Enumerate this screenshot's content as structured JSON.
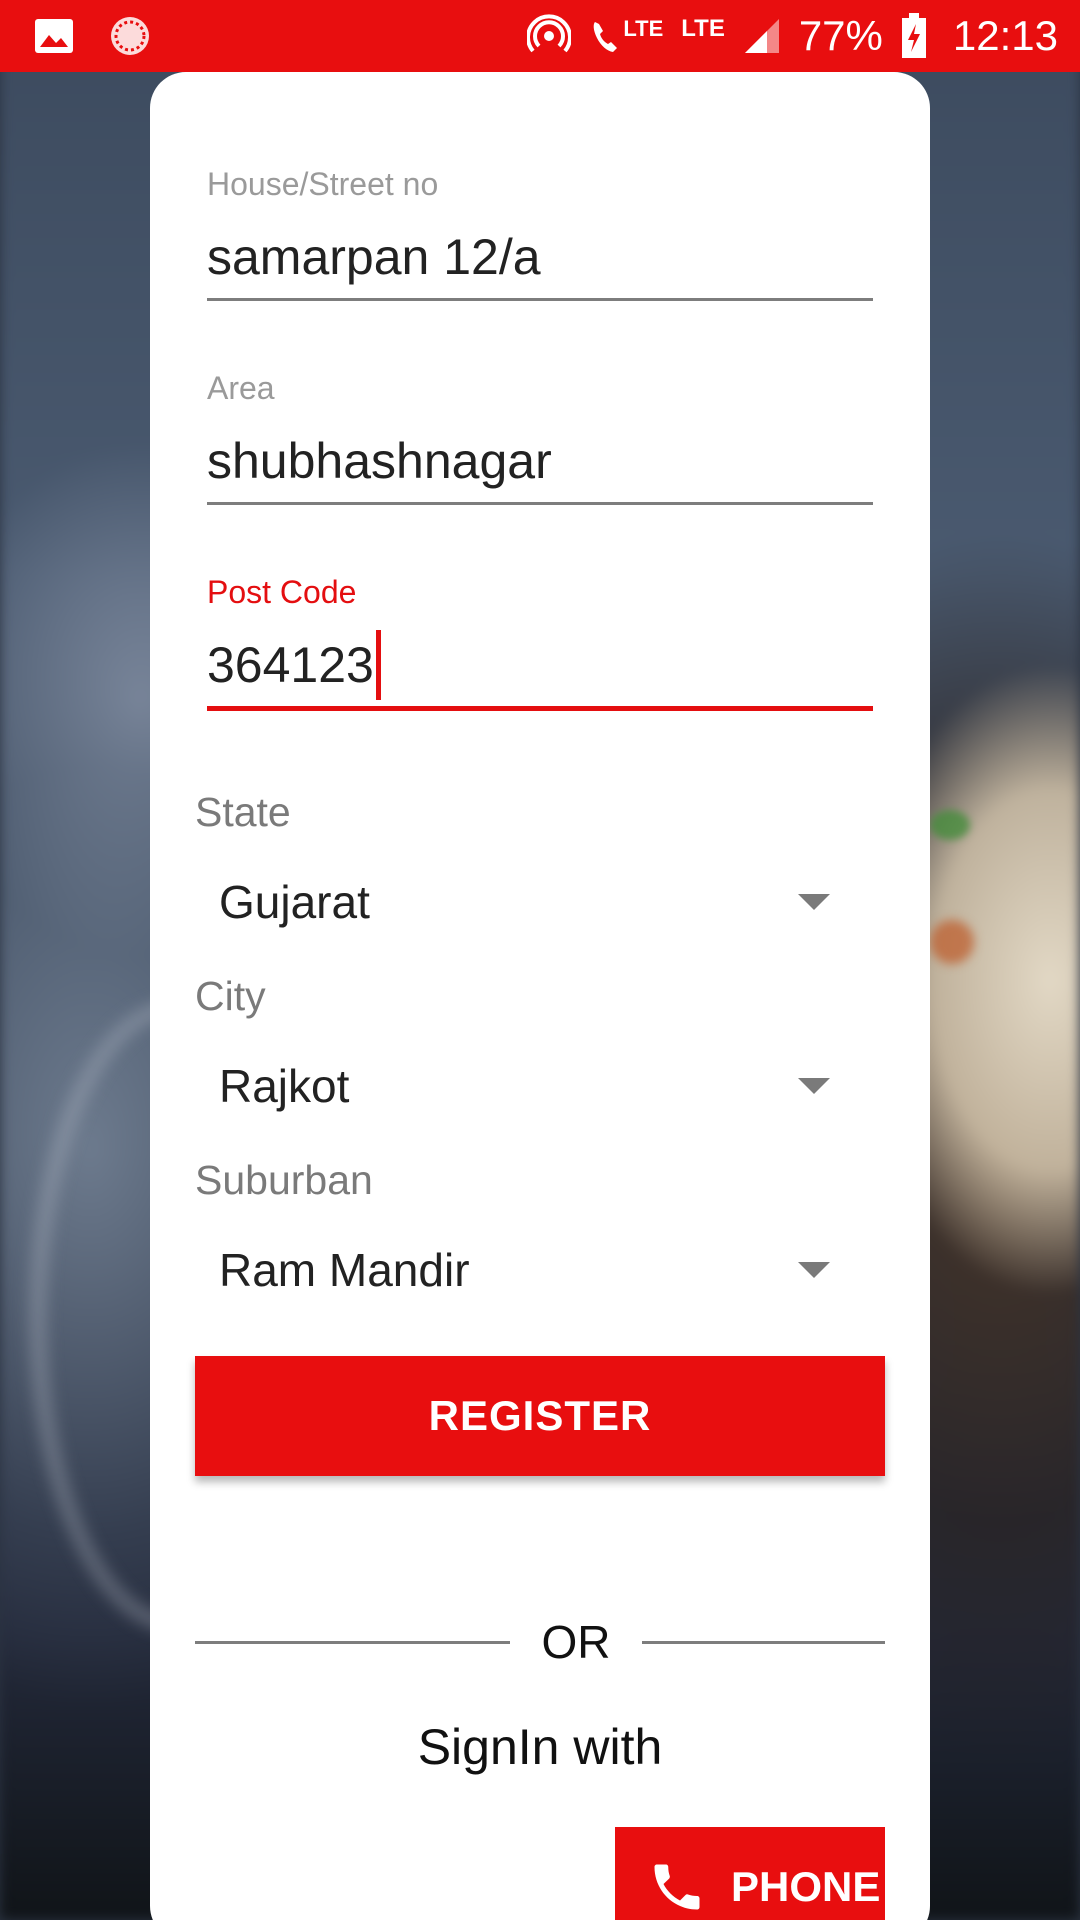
{
  "status_bar": {
    "lte_1": "LTE",
    "lte_2": "LTE",
    "battery": "77%",
    "time": "12:13",
    "color": "#e80e0f"
  },
  "form": {
    "house": {
      "label": "House/Street no",
      "value": "samarpan 12/a"
    },
    "area": {
      "label": "Area",
      "value": "shubhashnagar"
    },
    "postcode": {
      "label": "Post Code",
      "value": "364123"
    },
    "state": {
      "label": "State",
      "value": "Gujarat"
    },
    "city": {
      "label": "City",
      "value": "Rajkot"
    },
    "suburban": {
      "label": "Suburban",
      "value": "Ram Mandir"
    }
  },
  "actions": {
    "register_label": "REGISTER",
    "or_label": "OR",
    "signin_label": "SignIn with",
    "phone_label": "PHONE"
  },
  "colors": {
    "accent": "#e80e0f",
    "label_gray": "#9a9a9a",
    "text": "#222222"
  }
}
